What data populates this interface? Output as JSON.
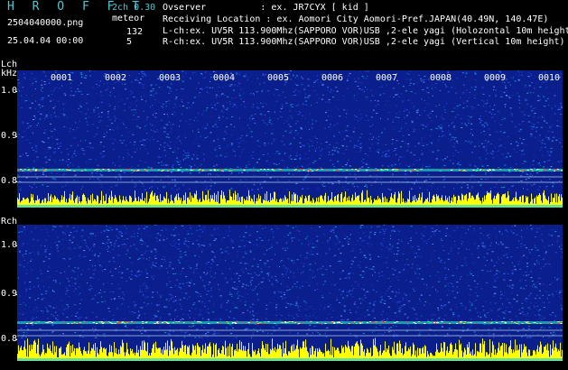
{
  "header": {
    "app_title": "H R O F F T",
    "filename": "2504040000.png",
    "timestamp": "25.04.04 00:00",
    "version": "2ch 0.30",
    "mode": "meteor",
    "count_1": "132",
    "count_2": "5",
    "observer": "Ovserver          : ex. JR7CYX [ kid ]",
    "location": "Receiving Location : ex. Aomori City Aomori-Pref.JAPAN(40.49N, 140.47E)",
    "lch_info": "L-ch:ex. UV5R 113.900Mhz(SAPPORO VOR)USB ,2-ele yagi (Holozontal 10m height)",
    "rch_info": "R-ch:ex. UV5R 113.900Mhz(SAPPORO VOR)USB ,2-ele yagi (Vertical 10m height)"
  },
  "channels": {
    "left": {
      "label": "Lch",
      "unit": "kHz",
      "ticks": [
        "1.0",
        "0.9",
        "0.8"
      ]
    },
    "right": {
      "label": "Rch",
      "ticks": [
        "1.0",
        "0.9",
        "0.8"
      ]
    }
  },
  "time_segments": [
    "0001",
    "0002",
    "0003",
    "0004",
    "0005",
    "0006",
    "0007",
    "0008",
    "0009",
    "0010"
  ],
  "colors": {
    "background": "#000000",
    "noise": "#0b1f8c",
    "signal": "#ffff00",
    "accent": "#4cc7d6"
  }
}
